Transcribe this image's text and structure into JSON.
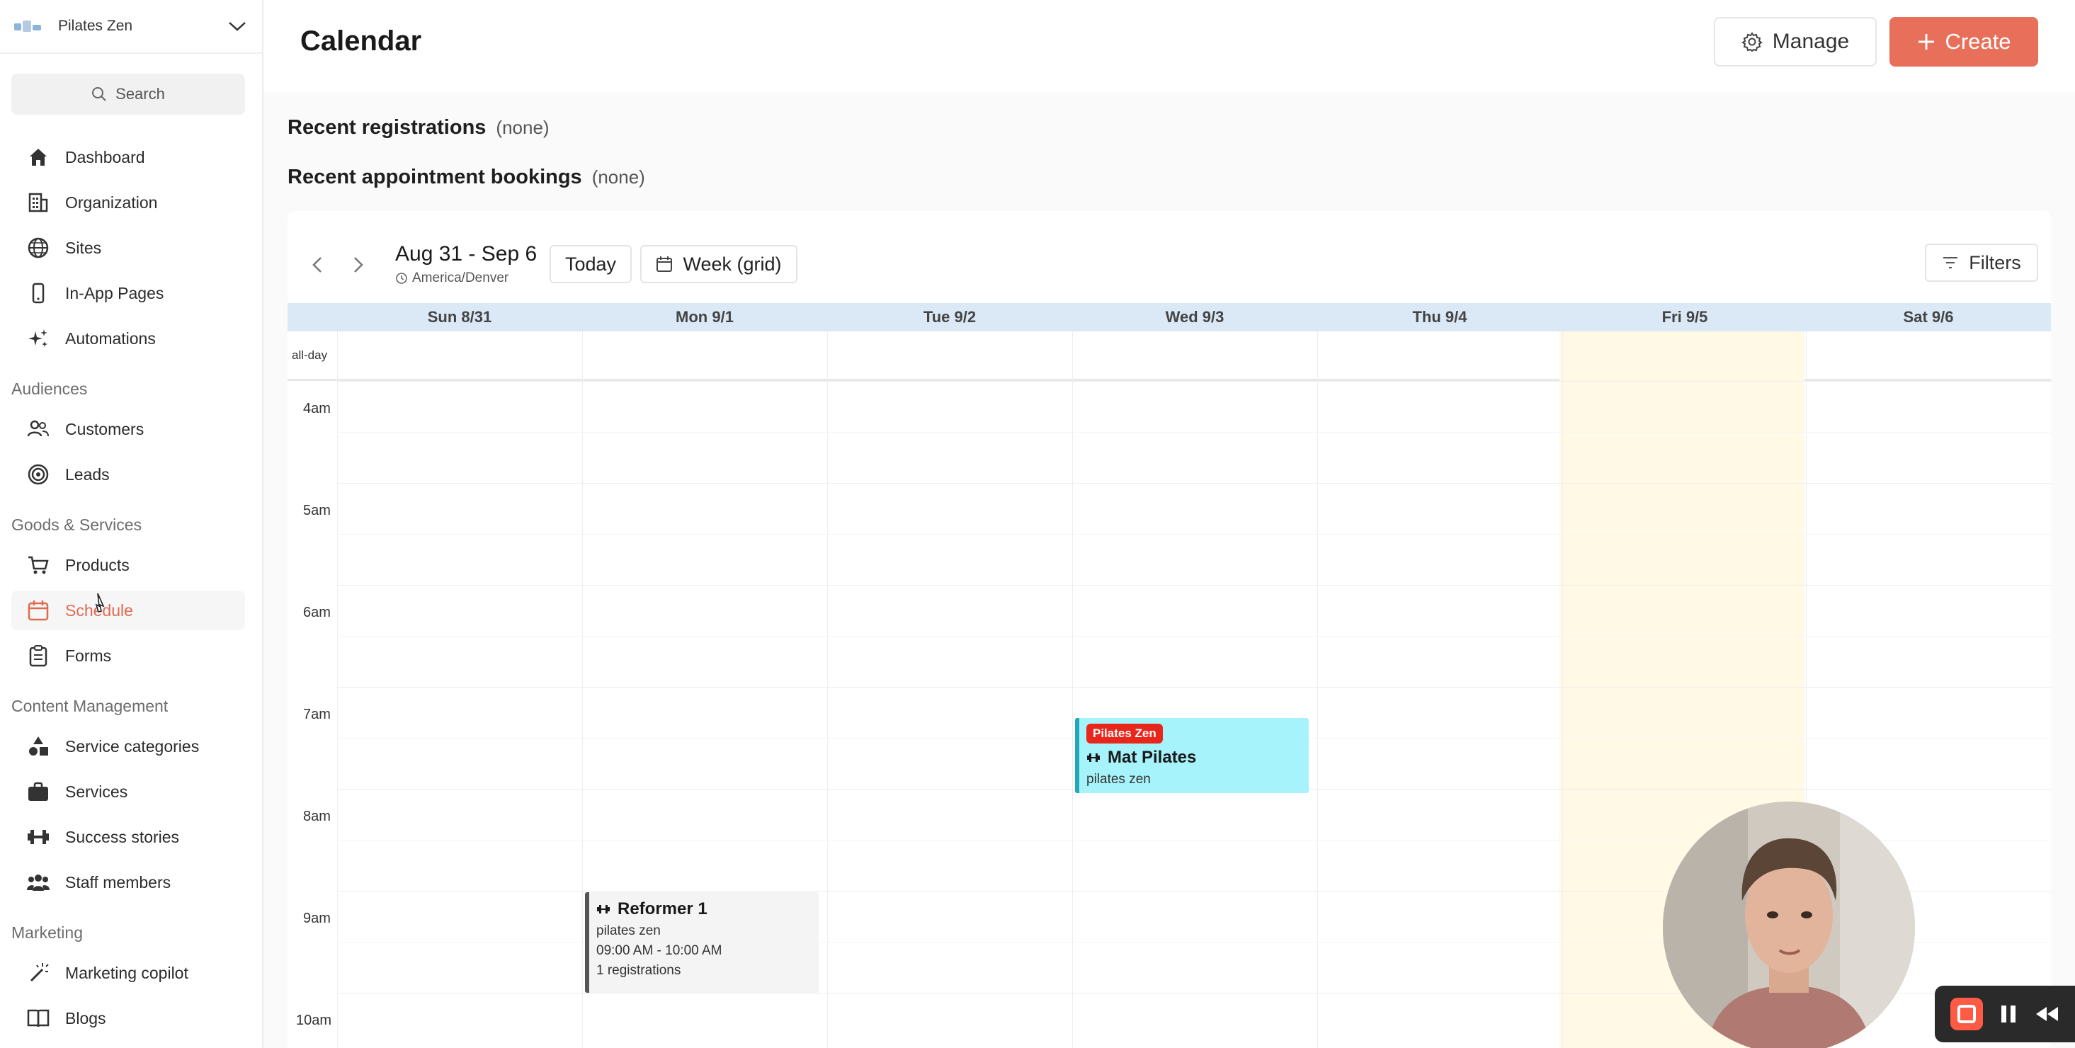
{
  "sidebar": {
    "org_name": "Pilates Zen",
    "search_label": "Search",
    "items": {
      "dashboard": "Dashboard",
      "organization": "Organization",
      "sites": "Sites",
      "in_app_pages": "In-App Pages",
      "automations": "Automations",
      "customers": "Customers",
      "leads": "Leads",
      "products": "Products",
      "schedule": "Schedule",
      "forms": "Forms",
      "service_categories": "Service categories",
      "services": "Services",
      "success_stories": "Success stories",
      "staff_members": "Staff members",
      "marketing_copilot": "Marketing copilot",
      "blogs": "Blogs"
    },
    "sections": {
      "audiences": "Audiences",
      "goods_services": "Goods & Services",
      "content_management": "Content Management",
      "marketing": "Marketing"
    },
    "active_item": "schedule",
    "accent_color": "#e06a50"
  },
  "header": {
    "title": "Calendar",
    "manage_label": "Manage",
    "create_label": "Create",
    "create_color": "#e8705a"
  },
  "recent": {
    "registrations_label": "Recent registrations",
    "registrations_value": "(none)",
    "bookings_label": "Recent appointment bookings",
    "bookings_value": "(none)"
  },
  "calendar": {
    "range": "Aug 31 - Sep 6",
    "timezone": "America/Denver",
    "today_label": "Today",
    "view_label": "Week (grid)",
    "filters_label": "Filters",
    "days": [
      "Sun 8/31",
      "Mon 9/1",
      "Tue 9/2",
      "Wed 9/3",
      "Thu 9/4",
      "Fri 9/5",
      "Sat 9/6"
    ],
    "highlighted_day": "Fri 9/5",
    "allday_label": "all-day",
    "hours": [
      "4am",
      "5am",
      "6am",
      "7am",
      "8am",
      "9am",
      "10am"
    ],
    "events": {
      "mat": {
        "badge": "Pilates Zen",
        "title": "Mat Pilates",
        "subtitle": "pilates zen",
        "day": "Wed 9/3",
        "color": "#a7f3fb"
      },
      "reformer": {
        "title": "Reformer 1",
        "subtitle": "pilates zen",
        "time": "09:00 AM - 10:00 AM",
        "registrations": "1 registrations",
        "day": "Mon 9/1"
      }
    }
  },
  "recorder": {
    "controls": [
      "record-stop-icon",
      "pause-icon",
      "rewind-icon"
    ]
  }
}
